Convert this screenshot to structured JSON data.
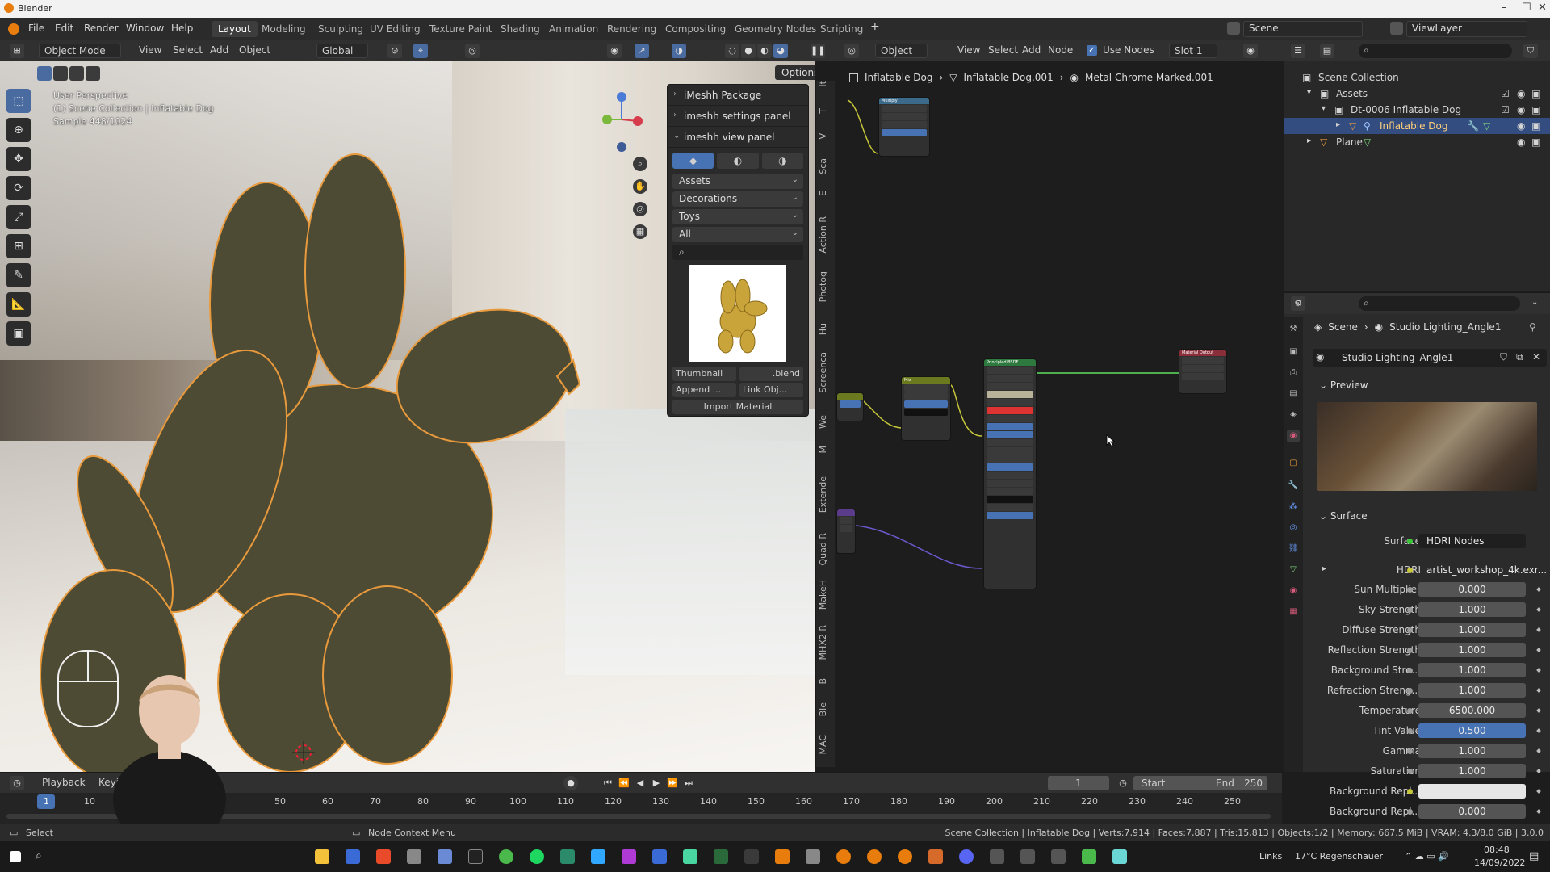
{
  "os": {
    "title": "Blender",
    "controls": [
      "–",
      "☐",
      "✕"
    ]
  },
  "menus": [
    "File",
    "Edit",
    "Render",
    "Window",
    "Help"
  ],
  "workspaces": [
    "Layout",
    "Modeling",
    "Sculpting",
    "UV Editing",
    "Texture Paint",
    "Shading",
    "Animation",
    "Rendering",
    "Compositing",
    "Geometry Nodes",
    "Scripting"
  ],
  "active_workspace": "Layout",
  "scene_selector": {
    "scene": "Scene",
    "view_layer": "ViewLayer"
  },
  "viewport_header": {
    "mode": "Object Mode",
    "menus": [
      "View",
      "Select",
      "Add",
      "Object"
    ],
    "transform": "Global",
    "options": "Options"
  },
  "viewport_overlay": {
    "line1": "User Perspective",
    "line2": "(1) Scene Collection | Inflatable Dog",
    "line3": "Sample 448/1024"
  },
  "imeshh": {
    "package": "iMeshh Package",
    "settings": "imeshh settings panel",
    "view": "imeshh view panel",
    "dropdowns": [
      "Assets",
      "Decorations",
      "Toys",
      "All"
    ],
    "thumbnail_btn": "Thumbnail",
    "blend_btn": ".blend",
    "append_btn": "Append ...",
    "link_btn": "Link Obj...",
    "import_btn": "Import Material"
  },
  "side_tabs": [
    "It",
    "T",
    "Vi",
    "Sca",
    "E",
    "Action R",
    "Photog",
    "Hu",
    "Screenca",
    "We",
    "M",
    "Extende",
    "Quad R",
    "MakeH",
    "MHX2 R",
    "B",
    "Ble",
    "MAC"
  ],
  "node_header": {
    "object_btn": "Object",
    "menus": [
      "View",
      "Select",
      "Add",
      "Node"
    ],
    "use_nodes": "Use Nodes",
    "slot": "Slot 1",
    "breadcrumb": [
      "Inflatable Dog",
      "Inflatable Dog.001",
      "Metal Chrome Marked.001"
    ]
  },
  "outliner": {
    "root": "Scene Collection",
    "rows": [
      {
        "label": "Assets",
        "indent": 1
      },
      {
        "label": "Dt-0006 Inflatable Dog",
        "indent": 2
      },
      {
        "label": "Inflatable Dog",
        "indent": 3,
        "selected": true
      },
      {
        "label": "Plane",
        "indent": 1
      }
    ]
  },
  "properties": {
    "breadcrumb_scene": "Scene",
    "breadcrumb_world": "Studio Lighting_Angle1",
    "world_name": "Studio Lighting_Angle1",
    "preview_label": "Preview",
    "surface_label": "Surface",
    "surface_value": "HDRI Nodes",
    "hdri_label": "HDRI",
    "hdri_value": "artist_workshop_4k.exr...",
    "fields": [
      {
        "label": "Sun Multiplier",
        "value": "0.000"
      },
      {
        "label": "Sky Strength",
        "value": "1.000"
      },
      {
        "label": "Diffuse Strength",
        "value": "1.000"
      },
      {
        "label": "Reflection Strength",
        "value": "1.000"
      },
      {
        "label": "Background Stre...",
        "value": "1.000"
      },
      {
        "label": "Refraction Streng...",
        "value": "1.000"
      },
      {
        "label": "Temperature",
        "value": "6500.000"
      },
      {
        "label": "Tint Value",
        "value": "0.500"
      },
      {
        "label": "Gamma",
        "value": "1.000"
      },
      {
        "label": "Saturation",
        "value": "1.000"
      },
      {
        "label": "Background Repl...",
        "value": ""
      },
      {
        "label": "Background Repl...",
        "value": "0.000"
      }
    ]
  },
  "timeline": {
    "playback": "Playback",
    "keying": "Keyin",
    "current_frame": "1",
    "start_label": "Start",
    "start": "1",
    "end_label": "End",
    "end": "250",
    "ticks": [
      "1",
      "10",
      "50",
      "60",
      "70",
      "80",
      "90",
      "100",
      "110",
      "120",
      "130",
      "140",
      "150",
      "160",
      "170",
      "180",
      "190",
      "200",
      "210",
      "220",
      "230",
      "240",
      "250"
    ]
  },
  "status": {
    "select": "Select",
    "context": "Node Context Menu",
    "info": "Scene Collection | Inflatable Dog | Verts:7,914 | Faces:7,887 | Tris:15,813 | Objects:1/2 | Memory: 667.5 MiB | VRAM: 4.3/8.0 GiB | 3.0.0"
  },
  "taskbar": {
    "links": "Links",
    "weather": "17°C  Regenschauer",
    "time": "08:48",
    "date": "14/09/2022"
  },
  "colors": {
    "selection_blue": "#334d80",
    "field_blue": "#4772b3",
    "accent_orange": "#e89a3c"
  }
}
